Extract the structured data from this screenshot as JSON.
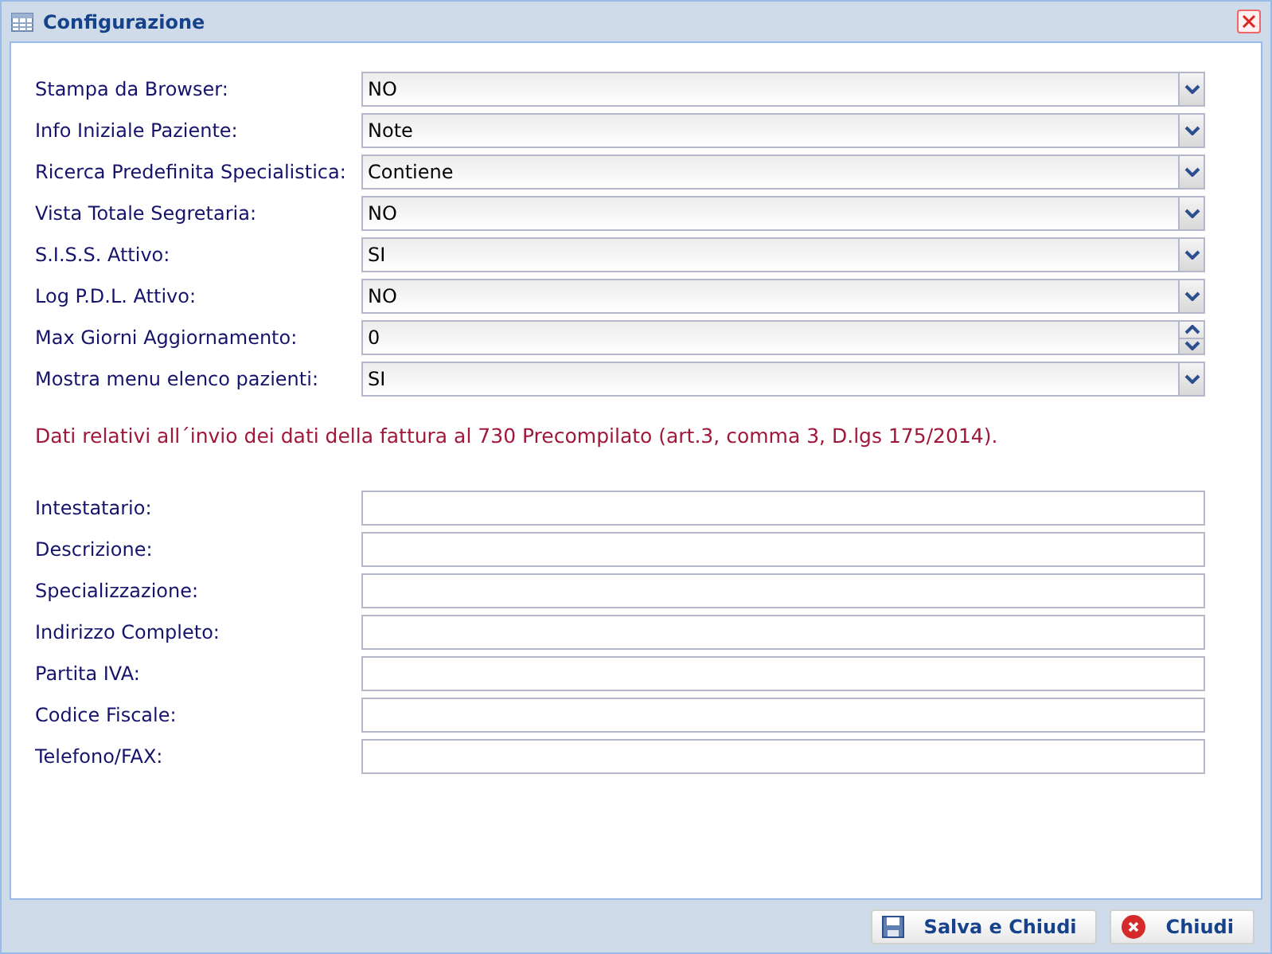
{
  "window": {
    "title": "Configurazione"
  },
  "settings": [
    {
      "label": "Stampa da Browser:",
      "kind": "select",
      "value": "NO"
    },
    {
      "label": "Info Iniziale Paziente:",
      "kind": "select",
      "value": "Note"
    },
    {
      "label": "Ricerca Predefinita Specialistica:",
      "kind": "select",
      "value": "Contiene"
    },
    {
      "label": "Vista Totale Segretaria:",
      "kind": "select",
      "value": "NO"
    },
    {
      "label": "S.I.S.S. Attivo:",
      "kind": "select",
      "value": "SI"
    },
    {
      "label": "Log P.D.L. Attivo:",
      "kind": "select",
      "value": "NO"
    },
    {
      "label": "Max Giorni Aggiornamento:",
      "kind": "number",
      "value": "0"
    },
    {
      "label": "Mostra menu elenco pazienti:",
      "kind": "select",
      "value": "SI"
    }
  ],
  "note": "Dati relativi all´invio dei dati della fattura al 730 Precompilato (art.3, comma 3, D.lgs 175/2014).",
  "invoice_fields": [
    {
      "label": "Intestatario:"
    },
    {
      "label": "Descrizione:"
    },
    {
      "label": "Specializzazione:"
    },
    {
      "label": "Indirizzo Completo:"
    },
    {
      "label": "Partita IVA:"
    },
    {
      "label": "Codice Fiscale:"
    },
    {
      "label": "Telefono/FAX:"
    }
  ],
  "buttons": [
    {
      "label": "Salva e Chiudi",
      "kind": "save"
    },
    {
      "label": "Chiudi",
      "kind": "close"
    }
  ]
}
